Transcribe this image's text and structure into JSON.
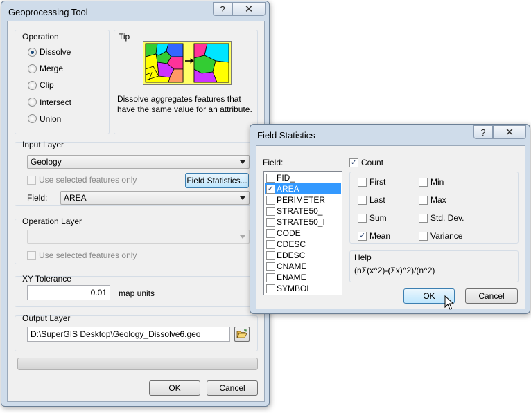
{
  "geo_window": {
    "title": "Geoprocessing Tool",
    "help_glyph": "?",
    "close_glyph": "✕",
    "operation": {
      "label": "Operation",
      "options": [
        "Dissolve",
        "Merge",
        "Clip",
        "Intersect",
        "Union"
      ],
      "selected": "Dissolve"
    },
    "tip": {
      "label": "Tip",
      "description": "Dissolve aggregates features that have the same value for an attribute."
    },
    "input_layer": {
      "label": "Input Layer",
      "value": "Geology",
      "use_selected_label": "Use selected features only",
      "field_stats_button": "Field Statistics...",
      "field_label": "Field:",
      "field_value": "AREA"
    },
    "operation_layer": {
      "label": "Operation Layer",
      "value": "",
      "use_selected_label": "Use selected features only"
    },
    "xy_tolerance": {
      "label": "XY Tolerance",
      "value": "0.01",
      "units": "map units"
    },
    "output_layer": {
      "label": "Output Layer",
      "path": "D:\\SuperGIS Desktop\\Geology_Dissolve6.geo"
    },
    "progress": 0,
    "ok_label": "OK",
    "cancel_label": "Cancel"
  },
  "stats_window": {
    "title": "Field Statistics",
    "help_glyph": "?",
    "close_glyph": "✕",
    "field_label": "Field:",
    "fields": [
      {
        "name": "FID_",
        "checked": false
      },
      {
        "name": "AREA",
        "checked": true
      },
      {
        "name": "PERIMETER",
        "checked": false
      },
      {
        "name": "STRATE50_",
        "checked": false
      },
      {
        "name": "STRATE50_I",
        "checked": false
      },
      {
        "name": "CODE",
        "checked": false
      },
      {
        "name": "CDESC",
        "checked": false
      },
      {
        "name": "EDESC",
        "checked": false
      },
      {
        "name": "CNAME",
        "checked": false
      },
      {
        "name": "ENAME",
        "checked": false
      },
      {
        "name": "SYMBOL",
        "checked": false
      }
    ],
    "selected_field": "AREA",
    "count_label": "Count",
    "count_checked": true,
    "stats": [
      {
        "name": "First",
        "checked": false
      },
      {
        "name": "Min",
        "checked": false
      },
      {
        "name": "Last",
        "checked": false
      },
      {
        "name": "Max",
        "checked": false
      },
      {
        "name": "Sum",
        "checked": false
      },
      {
        "name": "Std. Dev.",
        "checked": false
      },
      {
        "name": "Mean",
        "checked": true
      },
      {
        "name": "Variance",
        "checked": false
      }
    ],
    "help_label": "Help",
    "help_formula": "(nΣ(x^2)-(Σx)^2)/(n^2)",
    "ok_label": "OK",
    "cancel_label": "Cancel"
  },
  "colors": {
    "window_frame": "#cfdcea",
    "selection": "#3399ff",
    "accent_button": "#bee6fd"
  }
}
